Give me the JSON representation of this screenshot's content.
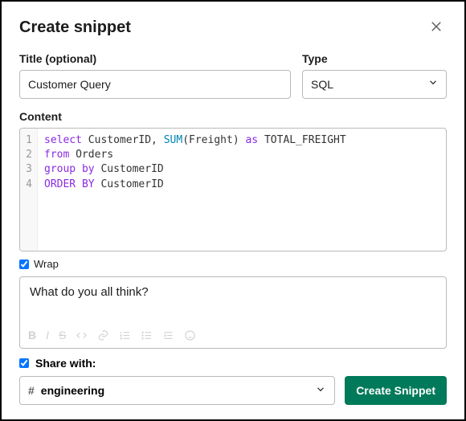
{
  "header": {
    "title": "Create snippet"
  },
  "fields": {
    "title_label": "Title (optional)",
    "title_value": "Customer Query",
    "type_label": "Type",
    "type_value": "SQL"
  },
  "content": {
    "label": "Content",
    "lines": [
      [
        [
          "kw",
          "select"
        ],
        [
          "p",
          " CustomerID, "
        ],
        [
          "fn",
          "SUM"
        ],
        [
          "p",
          "(Freight) "
        ],
        [
          "kw",
          "as"
        ],
        [
          "p",
          " TOTAL_FREIGHT"
        ]
      ],
      [
        [
          "kw",
          "from"
        ],
        [
          "p",
          " Orders"
        ]
      ],
      [
        [
          "kw",
          "group by"
        ],
        [
          "p",
          " CustomerID"
        ]
      ],
      [
        [
          "kw",
          "ORDER BY"
        ],
        [
          "p",
          " CustomerID"
        ]
      ]
    ]
  },
  "wrap": {
    "checked": true,
    "label": "Wrap"
  },
  "message": {
    "text": "What do you all think?",
    "toolbar": [
      "bold",
      "italic",
      "strike",
      "code",
      "link",
      "ordered-list",
      "unordered-list",
      "indent",
      "emoji"
    ]
  },
  "share": {
    "checked": true,
    "label": "Share with:",
    "channel": "engineering"
  },
  "actions": {
    "create": "Create Snippet"
  }
}
